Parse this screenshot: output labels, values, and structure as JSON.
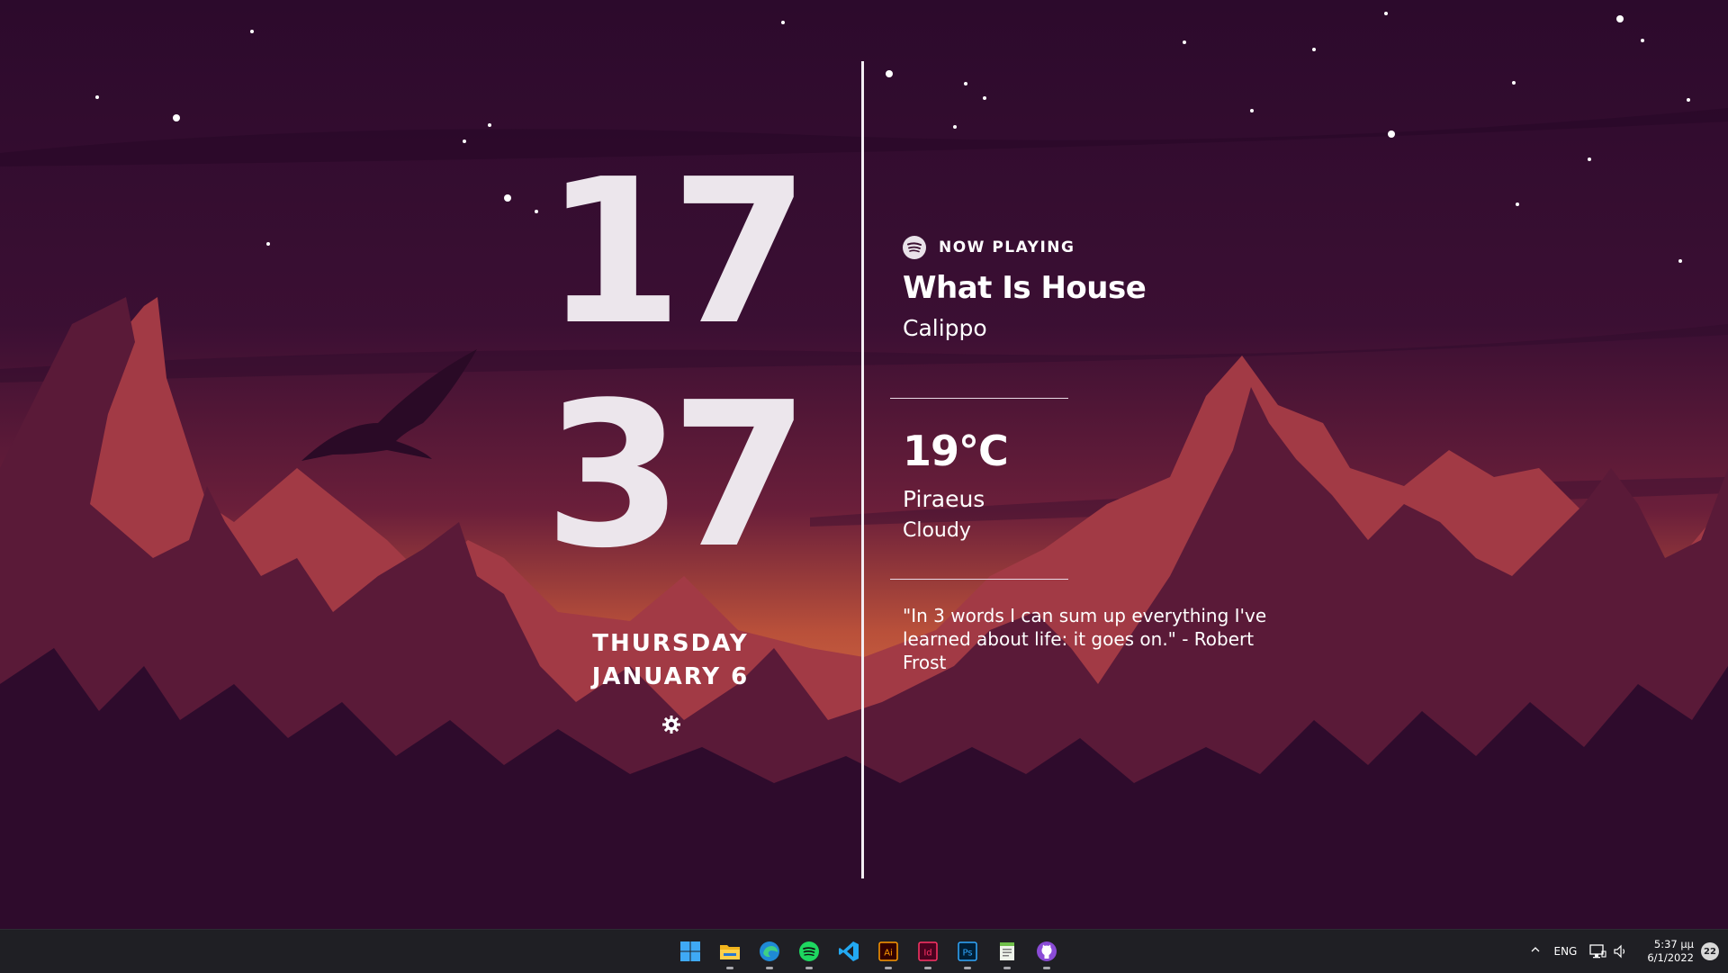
{
  "clock": {
    "hour": "17",
    "minute": "37",
    "day": "THURSDAY",
    "date": "JANUARY 6"
  },
  "now_playing": {
    "label": "NOW PLAYING",
    "title": "What Is House",
    "artist": "Calippo"
  },
  "weather": {
    "temperature": "19°C",
    "city": "Piraeus",
    "condition": "Cloudy"
  },
  "quote": {
    "text": "\"In 3 words I can sum up everything I've learned about life: it goes on.\" - Robert Frost"
  },
  "taskbar": {
    "apps": [
      {
        "name": "start-icon",
        "running": false
      },
      {
        "name": "file-explorer-icon",
        "running": true
      },
      {
        "name": "edge-icon",
        "running": true
      },
      {
        "name": "spotify-icon",
        "running": true
      },
      {
        "name": "vscode-icon",
        "running": false
      },
      {
        "name": "illustrator-icon",
        "running": true,
        "text": "Ai"
      },
      {
        "name": "indesign-icon",
        "running": true,
        "text": "Id"
      },
      {
        "name": "photoshop-icon",
        "running": true,
        "text": "Ps"
      },
      {
        "name": "notepad-icon",
        "running": true
      },
      {
        "name": "github-icon",
        "running": true
      }
    ],
    "tray": {
      "language": "ENG",
      "time": "5:37 μμ",
      "date": "6/1/2022",
      "notifications": "22"
    }
  },
  "colors": {
    "sky": "#2c0a2c",
    "glow": "#c75a3a",
    "mountain_red": "#a23a45",
    "text": "#ffffff"
  }
}
